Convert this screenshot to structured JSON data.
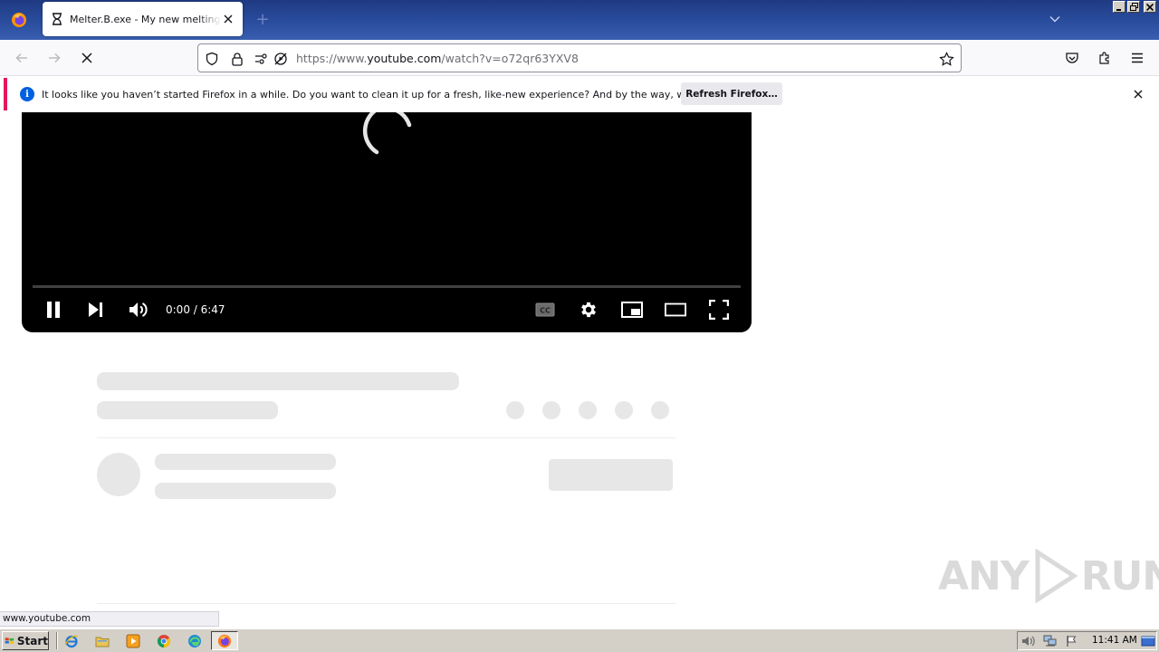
{
  "browser": {
    "tab": {
      "title": "Melter.B.exe - My new melting and",
      "favicon": "hourglass-icon"
    },
    "new_tab_label": "+",
    "url": {
      "prefix": "https://www.",
      "host": "youtube.com",
      "path": "/watch?v=o72qr63YXV8"
    },
    "notification": {
      "message": "It looks like you haven’t started Firefox in a while. Do you want to clean it up for a fresh, like-new experience? And by the way, welcome back!",
      "button_label": "Refresh Firefox…",
      "accent_color": "#e21a5d",
      "info_icon_text": "i"
    },
    "status_url": "www.youtube.com"
  },
  "player": {
    "time": "0:00 / 6:47",
    "progress_fraction": 0.0,
    "state": "loading",
    "controls": [
      "pause-icon",
      "next-icon",
      "volume-icon",
      "captions-icon",
      "settings-icon",
      "miniplayer-icon",
      "theater-icon",
      "fullscreen-icon"
    ]
  },
  "watermark": {
    "left": "ANY",
    "right": "RUN"
  },
  "taskbar": {
    "start_label": "Start",
    "clock": "11:41 AM",
    "quick_launch": [
      "ie-icon",
      "explorer-icon",
      "media-player-icon",
      "chrome-icon",
      "edge-icon"
    ],
    "active_app": "firefox-icon"
  }
}
